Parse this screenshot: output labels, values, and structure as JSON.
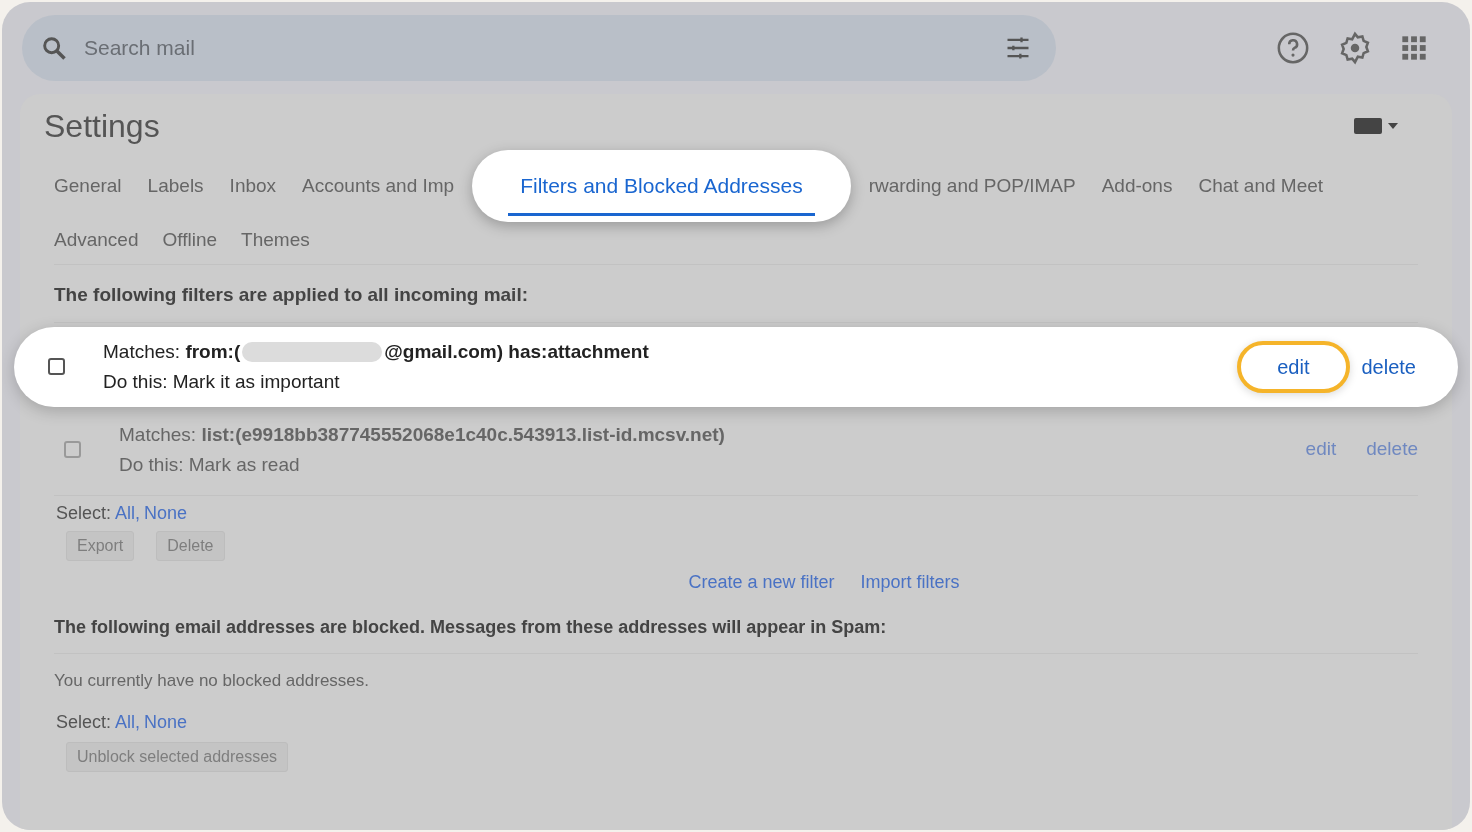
{
  "search": {
    "placeholder": "Search mail"
  },
  "title": "Settings",
  "tabs_row_1": [
    {
      "label": "General",
      "selected": false
    },
    {
      "label": "Labels",
      "selected": false
    },
    {
      "label": "Inbox",
      "selected": false
    },
    {
      "label": "Accounts and Imp",
      "selected": false
    },
    {
      "label": "Filters and Blocked Addresses",
      "selected": true
    },
    {
      "label": "rwarding and POP/IMAP",
      "selected": false
    },
    {
      "label": "Add-ons",
      "selected": false
    },
    {
      "label": "Chat and Meet",
      "selected": false
    }
  ],
  "tabs_row_2": [
    {
      "label": "Advanced",
      "selected": false
    },
    {
      "label": "Offline",
      "selected": false
    },
    {
      "label": "Themes",
      "selected": false
    }
  ],
  "filters_heading": "The following filters are applied to all incoming mail:",
  "filters": [
    {
      "highlighted": true,
      "checked": false,
      "matches": [
        {
          "kind": "text",
          "text": "Matches: **from:(**"
        },
        {
          "kind": "redaction"
        },
        {
          "kind": "text",
          "text": "@gmail.com) has:attachment",
          "bold": true
        }
      ],
      "action": "Do this: Mark it as important",
      "edit": {
        "label": "edit",
        "highlighted": true
      },
      "delete": "delete"
    },
    {
      "highlighted": false,
      "checked": false,
      "matches": [
        {
          "kind": "text",
          "text": "Matches: **list:(e9918bb387745552068e1c40c.543913.list-id.mcsv.net)**"
        }
      ],
      "action": "Do this: Mark as read",
      "edit": {
        "label": "edit",
        "highlighted": false
      },
      "delete": "delete"
    }
  ],
  "filter_select": {
    "label": "Select:",
    "links": [
      "All",
      "None"
    ],
    "separator": ","
  },
  "filter_buttons": [
    {
      "label": "Export",
      "disabled": true
    },
    {
      "label": "Delete",
      "disabled": true
    }
  ],
  "filter_links": [
    "Create a new filter",
    "Import filters"
  ],
  "blocked_heading": "The following email addresses are blocked. Messages from these addresses will appear in Spam:",
  "blocked_empty": "You currently have no blocked addresses.",
  "blocked_select": {
    "label": "Select:",
    "links": [
      "All",
      "None"
    ],
    "separator": ","
  },
  "blocked_buttons": [
    {
      "label": "Unblock selected addresses",
      "disabled": true
    }
  ]
}
